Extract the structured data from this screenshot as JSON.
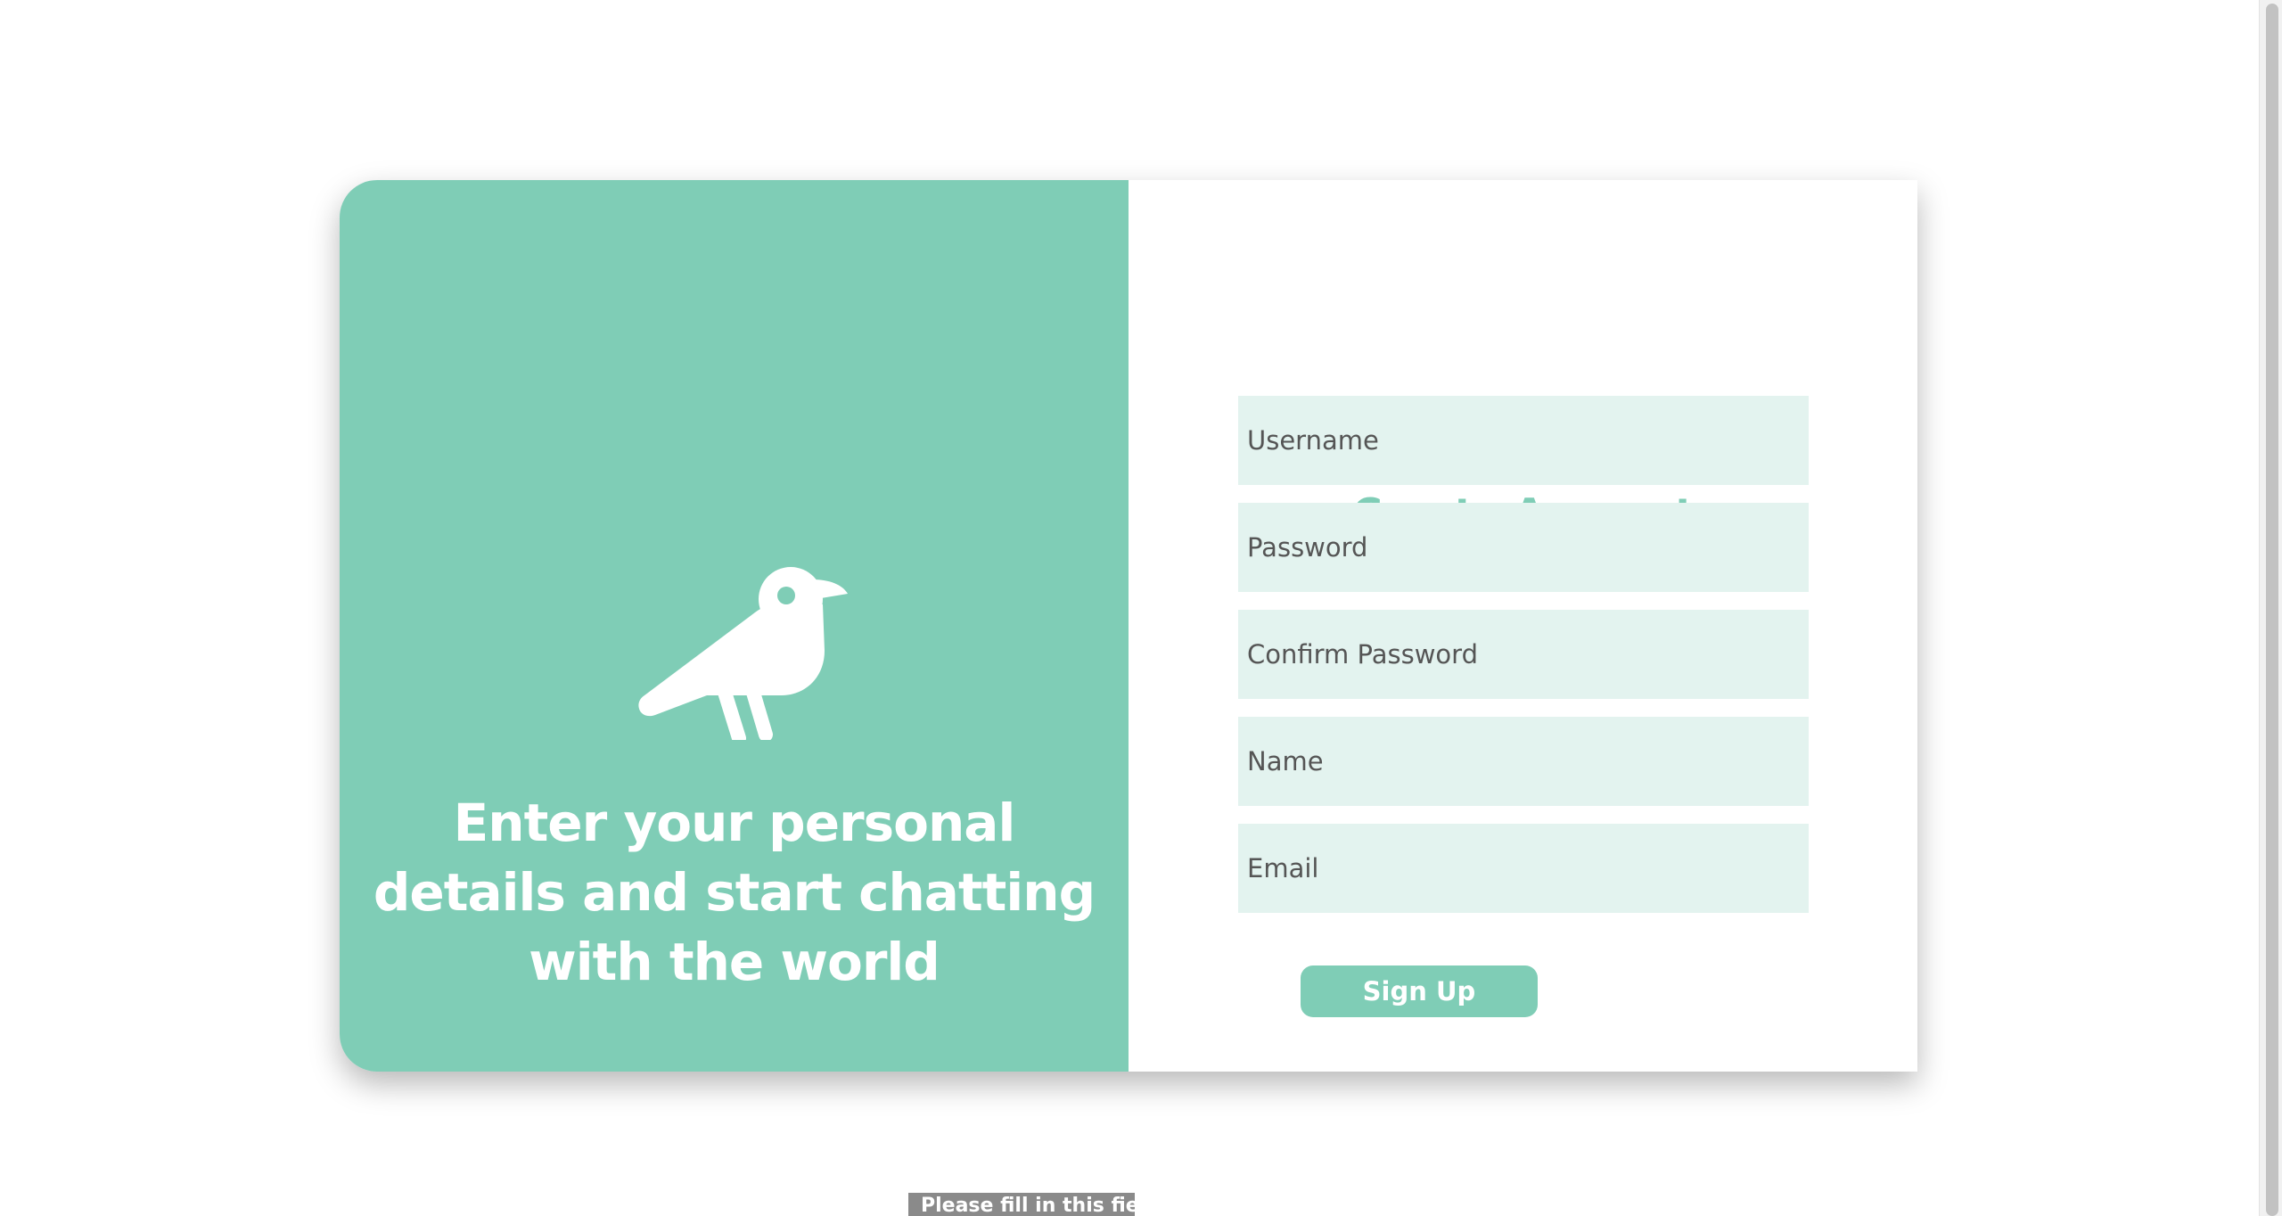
{
  "hero": {
    "icon": "bird-icon",
    "tagline": "Enter your personal details and start chatting with the world"
  },
  "form": {
    "title": "Create Account",
    "fields": {
      "username_placeholder": "Username",
      "password_placeholder": "Password",
      "confirm_password_placeholder": "Confirm Password",
      "name_placeholder": "Name",
      "email_placeholder": "Email"
    },
    "submit_label": "Sign Up"
  },
  "validation": {
    "tooltip": "Please fill in this field."
  },
  "colors": {
    "accent": "#7fcdb6",
    "field_bg": "#e3f3ef",
    "page_bg": "#ffffff"
  }
}
